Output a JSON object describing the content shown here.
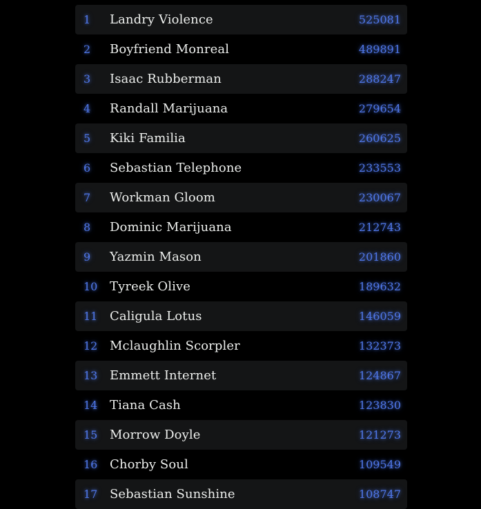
{
  "leaderboard": {
    "rows": [
      {
        "rank": "1",
        "name": "Landry Violence",
        "score": "525081"
      },
      {
        "rank": "2",
        "name": "Boyfriend Monreal",
        "score": "489891"
      },
      {
        "rank": "3",
        "name": "Isaac Rubberman",
        "score": "288247"
      },
      {
        "rank": "4",
        "name": "Randall Marijuana",
        "score": "279654"
      },
      {
        "rank": "5",
        "name": "Kiki Familia",
        "score": "260625"
      },
      {
        "rank": "6",
        "name": "Sebastian Telephone",
        "score": "233553"
      },
      {
        "rank": "7",
        "name": "Workman Gloom",
        "score": "230067"
      },
      {
        "rank": "8",
        "name": "Dominic Marijuana",
        "score": "212743"
      },
      {
        "rank": "9",
        "name": "Yazmin Mason",
        "score": "201860"
      },
      {
        "rank": "10",
        "name": "Tyreek Olive",
        "score": "189632"
      },
      {
        "rank": "11",
        "name": "Caligula Lotus",
        "score": "146059"
      },
      {
        "rank": "12",
        "name": "Mclaughlin Scorpler",
        "score": "132373"
      },
      {
        "rank": "13",
        "name": "Emmett Internet",
        "score": "124867"
      },
      {
        "rank": "14",
        "name": "Tiana Cash",
        "score": "123830"
      },
      {
        "rank": "15",
        "name": "Morrow Doyle",
        "score": "121273"
      },
      {
        "rank": "16",
        "name": "Chorby Soul",
        "score": "109549"
      },
      {
        "rank": "17",
        "name": "Sebastian Sunshine",
        "score": "108747"
      }
    ]
  },
  "colors": {
    "background": "#000000",
    "row_stripe": "#141516",
    "accent": "#4f77e8",
    "name_text": "#eef0ee"
  }
}
